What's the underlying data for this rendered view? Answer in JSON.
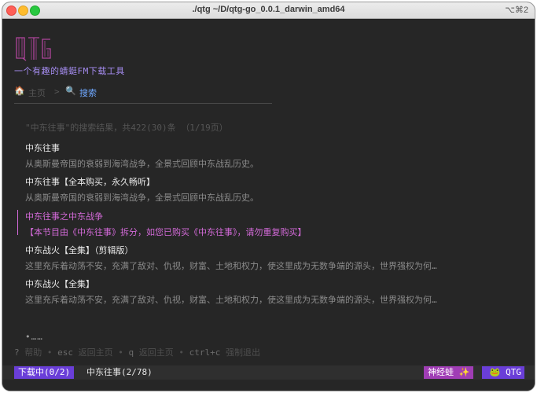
{
  "window": {
    "title": "./qtg  ~/D/qtg-go_0.0.1_darwin_amd64",
    "shortcut": "⌥⌘2"
  },
  "logo": {
    "text": "QTG",
    "color": "#b0459c"
  },
  "tagline": "一个有趣的蜻蜓FM下载工具",
  "breadcrumb": {
    "home_icon": "house-icon",
    "home": "主页",
    "separator": ">",
    "search_icon": "magnifier-icon",
    "search": "搜索"
  },
  "results": {
    "summary": "\"中东往事\"的搜索结果，共422(30)条 （1/19页）",
    "items": [
      {
        "title": "中东往事",
        "desc": "从奥斯曼帝国的衰弱到海湾战争，全景式回顾中东战乱历史。",
        "selected": false
      },
      {
        "title": "中东往事【全本购买，永久畅听】",
        "desc": "从奥斯曼帝国的衰弱到海湾战争，全景式回顾中东战乱历史。",
        "selected": false
      },
      {
        "title": "中东往事之中东战争",
        "desc": "【本节目由《中东往事》拆分，如您已购买《中东往事》，请勿重复购买】",
        "selected": true
      },
      {
        "title": "中东战火【全集】（剪辑版）",
        "desc": "这里充斥着动荡不安，充满了敌对、仇视，财富、土地和权力，使这里成为无数争端的源头，世界强权为何…",
        "selected": false
      },
      {
        "title": "中东战火【全集】",
        "desc": "这里充斥着动荡不安，充满了敌对、仇视，财富、土地和权力，使这里成为无数争端的源头，世界强权为何…",
        "selected": false
      }
    ]
  },
  "pager": "•……",
  "help": {
    "k1": "?",
    "v1": "帮助",
    "k2": "esc",
    "v2": "返回主页",
    "k3": "q",
    "v3": "返回主页",
    "k4": "ctrl+c",
    "v4": "强制退出",
    "sep": "•"
  },
  "status": {
    "downloading": "下载中(0/2)",
    "current": "中东往事(2/78)",
    "user": "神经蛙 ✨",
    "app_icon": "frog-icon",
    "app": "QTG"
  },
  "colors": {
    "accent": "#6a3ed8",
    "selected": "#d36ad8",
    "link": "#6fa8ff",
    "background": "#262626"
  }
}
